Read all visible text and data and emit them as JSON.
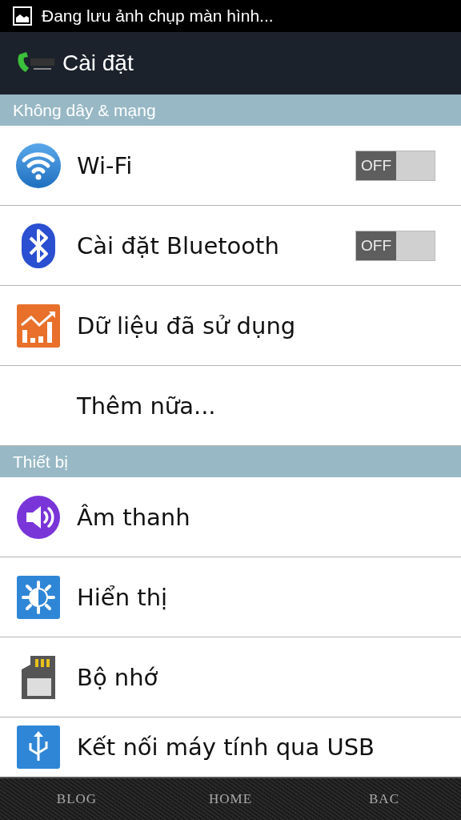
{
  "status_bar": {
    "notification": "Đang lưu ảnh chụp màn hình..."
  },
  "action_bar": {
    "title": "Cài đặt"
  },
  "sections": [
    {
      "header": "Không dây & mạng",
      "items": [
        {
          "kind": "toggle",
          "label": "Wi-Fi",
          "on": false,
          "switch_text": "OFF"
        },
        {
          "kind": "toggle",
          "label": "Cài đặt Bluetooth",
          "on": false,
          "switch_text": "OFF"
        },
        {
          "kind": "plain",
          "label": "Dữ liệu đã sử dụng"
        },
        {
          "kind": "plain",
          "label": "Thêm nữa..."
        }
      ]
    },
    {
      "header": "Thiết bị",
      "items": [
        {
          "kind": "plain",
          "label": "Âm thanh"
        },
        {
          "kind": "plain",
          "label": "Hiển thị"
        },
        {
          "kind": "plain",
          "label": "Bộ nhớ"
        },
        {
          "kind": "plain",
          "label": "Kết nối máy tính qua USB"
        }
      ]
    }
  ],
  "bottom_bar": [
    "BLOG",
    "HOME",
    "BAC"
  ]
}
